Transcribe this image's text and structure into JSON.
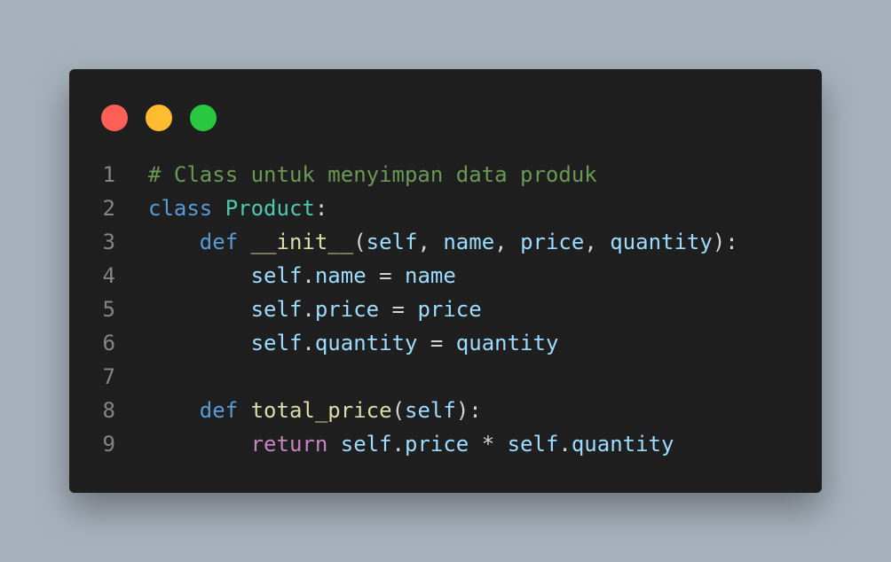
{
  "colors": {
    "background": "#a7b1bc",
    "window": "#1f1f1f",
    "close": "#ff5f57",
    "minimize": "#febc2e",
    "maximize": "#28c840",
    "line_number": "#858585",
    "comment": "#6a9955",
    "keyword": "#569cd6",
    "class_name": "#4ec9b0",
    "function": "#dcdcaa",
    "variable": "#9cdcfe",
    "control": "#c586c0",
    "plain": "#d4d4d4"
  },
  "window_controls": [
    "close-dot",
    "minimize-dot",
    "maximize-dot"
  ],
  "code": {
    "lines": [
      {
        "number": "1",
        "tokens": [
          {
            "text": "# Class untuk menyimpan data produk",
            "type": "comment"
          }
        ]
      },
      {
        "number": "2",
        "tokens": [
          {
            "text": "class",
            "type": "keyword"
          },
          {
            "text": " ",
            "type": "plain"
          },
          {
            "text": "Product",
            "type": "class"
          },
          {
            "text": ":",
            "type": "plain"
          }
        ]
      },
      {
        "number": "3",
        "tokens": [
          {
            "text": "    ",
            "type": "plain"
          },
          {
            "text": "def",
            "type": "keyword"
          },
          {
            "text": " ",
            "type": "plain"
          },
          {
            "text": "__init__",
            "type": "func"
          },
          {
            "text": "(",
            "type": "plain"
          },
          {
            "text": "self",
            "type": "var"
          },
          {
            "text": ", ",
            "type": "plain"
          },
          {
            "text": "name",
            "type": "var"
          },
          {
            "text": ", ",
            "type": "plain"
          },
          {
            "text": "price",
            "type": "var"
          },
          {
            "text": ", ",
            "type": "plain"
          },
          {
            "text": "quantity",
            "type": "var"
          },
          {
            "text": "):",
            "type": "plain"
          }
        ]
      },
      {
        "number": "4",
        "tokens": [
          {
            "text": "        ",
            "type": "plain"
          },
          {
            "text": "self",
            "type": "var"
          },
          {
            "text": ".",
            "type": "plain"
          },
          {
            "text": "name",
            "type": "var"
          },
          {
            "text": " = ",
            "type": "plain"
          },
          {
            "text": "name",
            "type": "var"
          }
        ]
      },
      {
        "number": "5",
        "tokens": [
          {
            "text": "        ",
            "type": "plain"
          },
          {
            "text": "self",
            "type": "var"
          },
          {
            "text": ".",
            "type": "plain"
          },
          {
            "text": "price",
            "type": "var"
          },
          {
            "text": " = ",
            "type": "plain"
          },
          {
            "text": "price",
            "type": "var"
          }
        ]
      },
      {
        "number": "6",
        "tokens": [
          {
            "text": "        ",
            "type": "plain"
          },
          {
            "text": "self",
            "type": "var"
          },
          {
            "text": ".",
            "type": "plain"
          },
          {
            "text": "quantity",
            "type": "var"
          },
          {
            "text": " = ",
            "type": "plain"
          },
          {
            "text": "quantity",
            "type": "var"
          }
        ]
      },
      {
        "number": "7",
        "tokens": []
      },
      {
        "number": "8",
        "tokens": [
          {
            "text": "    ",
            "type": "plain"
          },
          {
            "text": "def",
            "type": "keyword"
          },
          {
            "text": " ",
            "type": "plain"
          },
          {
            "text": "total_price",
            "type": "func"
          },
          {
            "text": "(",
            "type": "plain"
          },
          {
            "text": "self",
            "type": "var"
          },
          {
            "text": "):",
            "type": "plain"
          }
        ]
      },
      {
        "number": "9",
        "tokens": [
          {
            "text": "        ",
            "type": "plain"
          },
          {
            "text": "return",
            "type": "control"
          },
          {
            "text": " ",
            "type": "plain"
          },
          {
            "text": "self",
            "type": "var"
          },
          {
            "text": ".",
            "type": "plain"
          },
          {
            "text": "price",
            "type": "var"
          },
          {
            "text": " * ",
            "type": "plain"
          },
          {
            "text": "self",
            "type": "var"
          },
          {
            "text": ".",
            "type": "plain"
          },
          {
            "text": "quantity",
            "type": "var"
          }
        ]
      }
    ]
  }
}
